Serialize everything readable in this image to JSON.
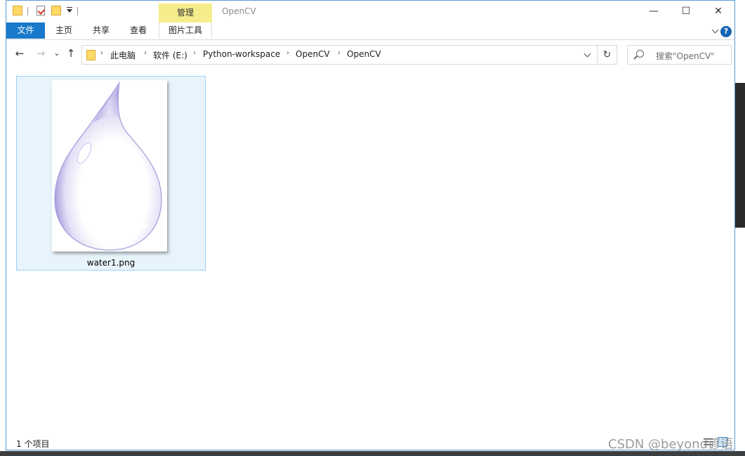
{
  "window": {
    "title": "OpenCV",
    "contextual_tab_group": "管理",
    "controls": {
      "minimize": "—",
      "maximize": "☐",
      "close": "✕"
    }
  },
  "ribbon": {
    "tabs": [
      "文件",
      "主页",
      "共享",
      "查看",
      "图片工具"
    ],
    "active_tab_color": "#1979ca",
    "contextual_color": "#f5ed8c",
    "help": "?"
  },
  "navigation": {
    "back": "←",
    "forward": "→",
    "recent": "⌄",
    "up": "↑",
    "breadcrumb": [
      "此电脑",
      "软件 (E:)",
      "Python-workspace",
      "OpenCV",
      "OpenCV"
    ],
    "refresh": "↻",
    "search_placeholder": "搜索\"OpenCV\""
  },
  "files": [
    {
      "name": "water1.png",
      "icon": "water-drop-thumbnail"
    }
  ],
  "status": {
    "item_count": "1 个项目"
  },
  "watermark": "CSDN @beyond谚语"
}
